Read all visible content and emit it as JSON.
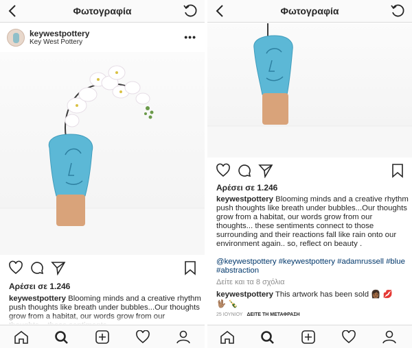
{
  "header": {
    "title": "Φωτογραφία"
  },
  "post": {
    "username": "keywestpottery",
    "location": "Key West Pottery",
    "likes": "Αρέσει σε 1.246",
    "caption_user": "keywestpottery",
    "caption_text": "Blooming minds and a creative rhythm push thoughts like breath under bubbles...Our thoughts grow from a habitat, our words grow from our thoughts... these sentiments connect to those surrounding and their reactions fall like rain onto our environment again.. so, reflect on beauty .",
    "caption_text_left": "Blooming minds and a creative rhythm push thoughts like breath under bubbles...Our thoughts grow from a habitat, our words grow from our thoughts... these sentiments",
    "hashtags": "@keywestpottery #keywestpottery #adamrussell #blue #abstraction",
    "view_comments": "Δείτε και τα 8 σχόλια",
    "comment_user": "keywestpottery",
    "comment_text": "This artwork has been sold 👩🏾 💋",
    "comment_emojis": "🖖🏽 🍾",
    "date": "25 ΙΟΥΝΙΟΥ",
    "translate": "ΔΕΙΤΕ ΤΗ ΜΕΤΑΦΡΑΣΗ"
  },
  "tabs": [
    "home-icon",
    "search-icon",
    "add-icon",
    "heart-icon",
    "profile-icon"
  ],
  "colors": {
    "vase_blue": "#5cb8d6",
    "vase_base": "#d9a37a",
    "link": "#00376b"
  }
}
